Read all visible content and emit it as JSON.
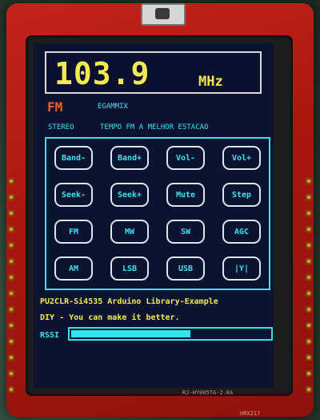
{
  "radio": {
    "frequency": "103.9",
    "unit": "MHz",
    "band": "FM",
    "station_name": "EGAMMIX",
    "stereo": "STEREO",
    "rds_text": "TEMPO FM A MELHOR ESTACAO"
  },
  "buttons": [
    {
      "label": "Band-"
    },
    {
      "label": "Band+"
    },
    {
      "label": "Vol-"
    },
    {
      "label": "Vol+"
    },
    {
      "label": "Seek-"
    },
    {
      "label": "Seek+"
    },
    {
      "label": "Mute"
    },
    {
      "label": "Step"
    },
    {
      "label": "FM"
    },
    {
      "label": "MW"
    },
    {
      "label": "SW"
    },
    {
      "label": "AGC"
    },
    {
      "label": "AM"
    },
    {
      "label": "LSB"
    },
    {
      "label": "USB"
    },
    {
      "label": "|Y|"
    }
  ],
  "footer": {
    "library": "PU2CLR-Si4535 Arduino Library-Example",
    "slogan": "DIY - You can make it better.",
    "rssi_label": "RSSI",
    "rssi_level": 0.6
  },
  "board": {
    "silk_model": "RJ-HY005TA-2.8A",
    "silk_code": "HRX217"
  },
  "colors": {
    "text_yellow": "#f2ea4e",
    "accent_cyan": "#36e4ee",
    "band_orange": "#ff5a22",
    "screen_bg": "#0c1330",
    "pcb_red": "#b11a12"
  }
}
